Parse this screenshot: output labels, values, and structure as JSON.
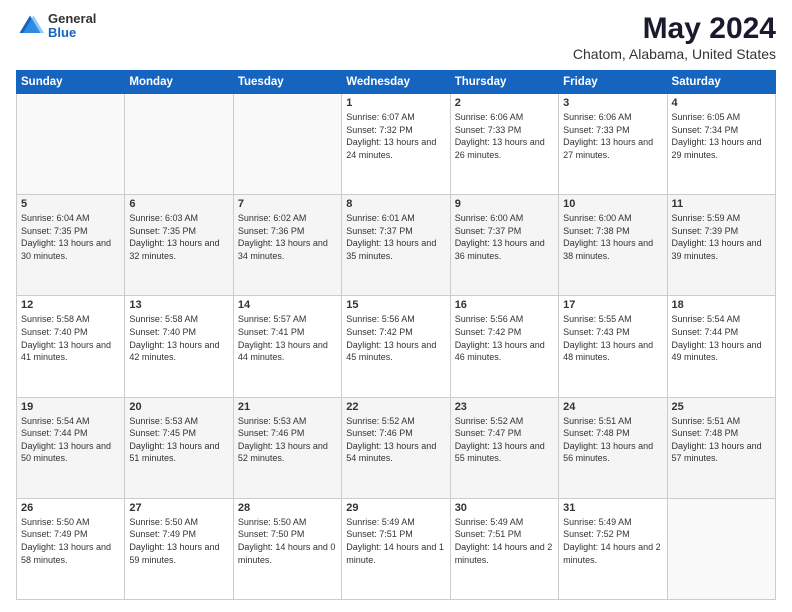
{
  "logo": {
    "general": "General",
    "blue": "Blue"
  },
  "title": "May 2024",
  "subtitle": "Chatom, Alabama, United States",
  "days_of_week": [
    "Sunday",
    "Monday",
    "Tuesday",
    "Wednesday",
    "Thursday",
    "Friday",
    "Saturday"
  ],
  "weeks": [
    [
      {
        "day": "",
        "info": ""
      },
      {
        "day": "",
        "info": ""
      },
      {
        "day": "",
        "info": ""
      },
      {
        "day": "1",
        "info": "Sunrise: 6:07 AM\nSunset: 7:32 PM\nDaylight: 13 hours\nand 24 minutes."
      },
      {
        "day": "2",
        "info": "Sunrise: 6:06 AM\nSunset: 7:33 PM\nDaylight: 13 hours\nand 26 minutes."
      },
      {
        "day": "3",
        "info": "Sunrise: 6:06 AM\nSunset: 7:33 PM\nDaylight: 13 hours\nand 27 minutes."
      },
      {
        "day": "4",
        "info": "Sunrise: 6:05 AM\nSunset: 7:34 PM\nDaylight: 13 hours\nand 29 minutes."
      }
    ],
    [
      {
        "day": "5",
        "info": "Sunrise: 6:04 AM\nSunset: 7:35 PM\nDaylight: 13 hours\nand 30 minutes."
      },
      {
        "day": "6",
        "info": "Sunrise: 6:03 AM\nSunset: 7:35 PM\nDaylight: 13 hours\nand 32 minutes."
      },
      {
        "day": "7",
        "info": "Sunrise: 6:02 AM\nSunset: 7:36 PM\nDaylight: 13 hours\nand 34 minutes."
      },
      {
        "day": "8",
        "info": "Sunrise: 6:01 AM\nSunset: 7:37 PM\nDaylight: 13 hours\nand 35 minutes."
      },
      {
        "day": "9",
        "info": "Sunrise: 6:00 AM\nSunset: 7:37 PM\nDaylight: 13 hours\nand 36 minutes."
      },
      {
        "day": "10",
        "info": "Sunrise: 6:00 AM\nSunset: 7:38 PM\nDaylight: 13 hours\nand 38 minutes."
      },
      {
        "day": "11",
        "info": "Sunrise: 5:59 AM\nSunset: 7:39 PM\nDaylight: 13 hours\nand 39 minutes."
      }
    ],
    [
      {
        "day": "12",
        "info": "Sunrise: 5:58 AM\nSunset: 7:40 PM\nDaylight: 13 hours\nand 41 minutes."
      },
      {
        "day": "13",
        "info": "Sunrise: 5:58 AM\nSunset: 7:40 PM\nDaylight: 13 hours\nand 42 minutes."
      },
      {
        "day": "14",
        "info": "Sunrise: 5:57 AM\nSunset: 7:41 PM\nDaylight: 13 hours\nand 44 minutes."
      },
      {
        "day": "15",
        "info": "Sunrise: 5:56 AM\nSunset: 7:42 PM\nDaylight: 13 hours\nand 45 minutes."
      },
      {
        "day": "16",
        "info": "Sunrise: 5:56 AM\nSunset: 7:42 PM\nDaylight: 13 hours\nand 46 minutes."
      },
      {
        "day": "17",
        "info": "Sunrise: 5:55 AM\nSunset: 7:43 PM\nDaylight: 13 hours\nand 48 minutes."
      },
      {
        "day": "18",
        "info": "Sunrise: 5:54 AM\nSunset: 7:44 PM\nDaylight: 13 hours\nand 49 minutes."
      }
    ],
    [
      {
        "day": "19",
        "info": "Sunrise: 5:54 AM\nSunset: 7:44 PM\nDaylight: 13 hours\nand 50 minutes."
      },
      {
        "day": "20",
        "info": "Sunrise: 5:53 AM\nSunset: 7:45 PM\nDaylight: 13 hours\nand 51 minutes."
      },
      {
        "day": "21",
        "info": "Sunrise: 5:53 AM\nSunset: 7:46 PM\nDaylight: 13 hours\nand 52 minutes."
      },
      {
        "day": "22",
        "info": "Sunrise: 5:52 AM\nSunset: 7:46 PM\nDaylight: 13 hours\nand 54 minutes."
      },
      {
        "day": "23",
        "info": "Sunrise: 5:52 AM\nSunset: 7:47 PM\nDaylight: 13 hours\nand 55 minutes."
      },
      {
        "day": "24",
        "info": "Sunrise: 5:51 AM\nSunset: 7:48 PM\nDaylight: 13 hours\nand 56 minutes."
      },
      {
        "day": "25",
        "info": "Sunrise: 5:51 AM\nSunset: 7:48 PM\nDaylight: 13 hours\nand 57 minutes."
      }
    ],
    [
      {
        "day": "26",
        "info": "Sunrise: 5:50 AM\nSunset: 7:49 PM\nDaylight: 13 hours\nand 58 minutes."
      },
      {
        "day": "27",
        "info": "Sunrise: 5:50 AM\nSunset: 7:49 PM\nDaylight: 13 hours\nand 59 minutes."
      },
      {
        "day": "28",
        "info": "Sunrise: 5:50 AM\nSunset: 7:50 PM\nDaylight: 14 hours\nand 0 minutes."
      },
      {
        "day": "29",
        "info": "Sunrise: 5:49 AM\nSunset: 7:51 PM\nDaylight: 14 hours\nand 1 minute."
      },
      {
        "day": "30",
        "info": "Sunrise: 5:49 AM\nSunset: 7:51 PM\nDaylight: 14 hours\nand 2 minutes."
      },
      {
        "day": "31",
        "info": "Sunrise: 5:49 AM\nSunset: 7:52 PM\nDaylight: 14 hours\nand 2 minutes."
      },
      {
        "day": "",
        "info": ""
      }
    ]
  ]
}
